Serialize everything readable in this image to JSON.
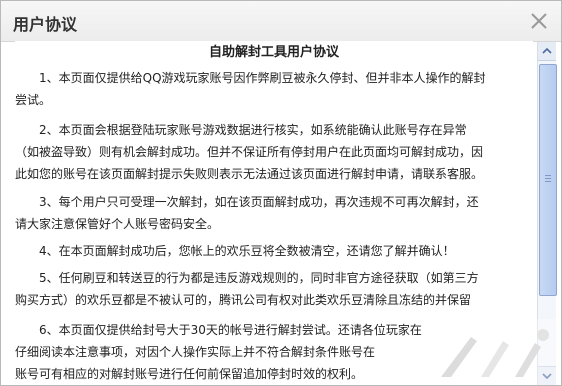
{
  "dialog": {
    "title": "用户协议",
    "close_symbol": "×"
  },
  "document": {
    "title": "自助解封工具用户协议",
    "paragraphs": [
      {
        "lines": [
          "1、本页面仅提供给QQ游戏玩家账号因作弊刷豆被永久停封、但并非本人操作的解封",
          "尝试。"
        ]
      },
      {
        "lines": [
          "2、本页面会根据登陆玩家账号游戏数据进行核实，如系统能确认此账号存在异常",
          "（如被盗导致）则有机会解封成功。但并不保证所有停封用户在此页面均可解封成功，因",
          "此如您的账号在该页面解封提示失败则表示无法通过该页面进行解封申请，请联系客服。"
        ]
      },
      {
        "lines": [
          "3、每个用户只可受理一次解封，如在该页面解封成功，再次违规不可再次解封，还",
          "请大家注意保管好个人账号密码安全。"
        ]
      },
      {
        "lines": [
          "4、在本页面解封成功后，您帐上的欢乐豆将全数被清空，还请您了解并确认！"
        ]
      },
      {
        "lines": [
          "5、任何刷豆和转送豆的行为都是违反游戏规则的，同时非官方途径获取（如第三方",
          "购买方式）的欢乐豆都是不被认可的，腾讯公司有权对此类欢乐豆清除且冻结的并保留"
        ]
      },
      {
        "lines": [
          "6、本页面仅提供给封号大于30天的帐号进行解封尝试。还请各位玩家在",
          "仔细阅读本注意事项，对因个人操作实际上并不符合解封条件账号在",
          "账号可有相应的对解封账号进行任何前保留追加停封时效的权利。"
        ]
      }
    ]
  },
  "colors": {
    "titlebar": "#efefef",
    "border": "#b9b9b9",
    "scroll_thumb": "#b5cbef"
  },
  "icons": {
    "close": "close-icon",
    "scroll_up": "chevron-up-icon",
    "scroll_down": "chevron-down-icon"
  }
}
